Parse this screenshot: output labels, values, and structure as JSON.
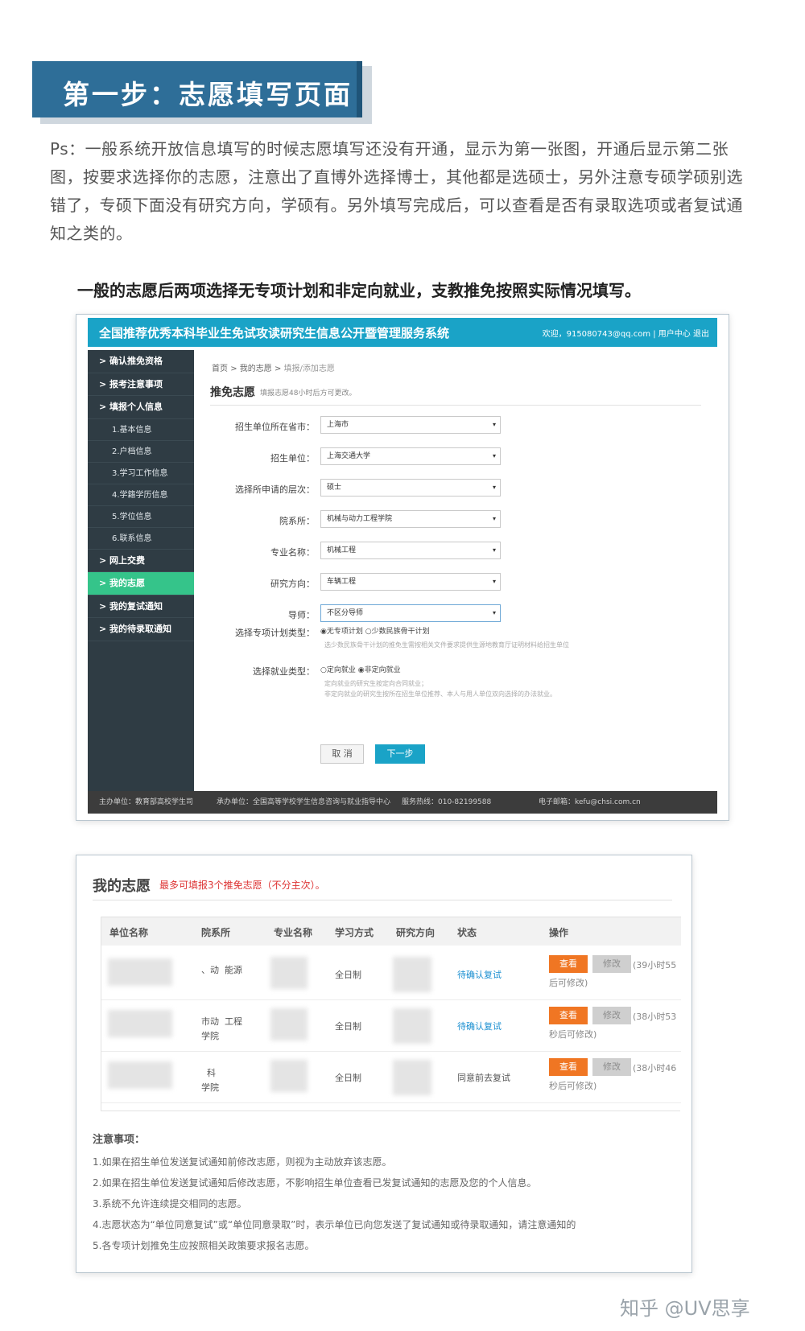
{
  "banner": {
    "title": "第一步：志愿填写页面"
  },
  "intro": "Ps：一般系统开放信息填写的时候志愿填写还没有开通，显示为第一张图，开通后显示第二张图，按要求选择你的志愿，注意出了直博外选择博士，其他都是选硕士，另外注意专硕学硕别选错了，专硕下面没有研究方向，学硕有。另外填写完成后，可以查看是否有录取选项或者复试通知之类的。",
  "subhead": "一般的志愿后两项选择无专项计划和非定向就业，支教推免按照实际情况填写。",
  "screen1": {
    "system_title": "全国推荐优秀本科毕业生免试攻读研究生信息公开暨管理服务系统",
    "user_bar": "欢迎，915080743@qq.com | 用户中心  退出",
    "sidebar": [
      {
        "label": "> 确认推免资格",
        "type": "item"
      },
      {
        "label": "> 报考注意事项",
        "type": "item"
      },
      {
        "label": "> 填报个人信息",
        "type": "item"
      },
      {
        "label": "1.基本信息",
        "type": "sub"
      },
      {
        "label": "2.户档信息",
        "type": "sub"
      },
      {
        "label": "3.学习工作信息",
        "type": "sub"
      },
      {
        "label": "4.学籍学历信息",
        "type": "sub"
      },
      {
        "label": "5.学位信息",
        "type": "sub"
      },
      {
        "label": "6.联系信息",
        "type": "sub"
      },
      {
        "label": "> 网上交费",
        "type": "item"
      },
      {
        "label": "> 我的志愿",
        "type": "active"
      },
      {
        "label": "> 我的复试通知",
        "type": "item"
      },
      {
        "label": "> 我的待录取通知",
        "type": "item"
      }
    ],
    "breadcrumb": {
      "home": "首页",
      "mine": "我的志愿",
      "current": "填报/添加志愿"
    },
    "form_title": "推免志愿",
    "form_note": "填报志愿48小时后方可更改。",
    "fields": [
      {
        "label": "招生单位所在省市：",
        "value": "上海市"
      },
      {
        "label": "招生单位：",
        "value": "上海交通大学"
      },
      {
        "label": "选择所申请的层次：",
        "value": "硕士"
      },
      {
        "label": "院系所：",
        "value": "机械与动力工程学院"
      },
      {
        "label": "专业名称：",
        "value": "机械工程"
      },
      {
        "label": "研究方向：",
        "value": "车辆工程"
      },
      {
        "label": "导师：",
        "value": "不区分导师"
      }
    ],
    "plan": {
      "label": "选择专项计划类型：",
      "options": "◉无专项计划 ○少数民族骨干计划",
      "hint": "选少数民族骨干计划的推免生需按相关文件要求提供生源地教育厅证明材料给招生单位"
    },
    "employ": {
      "label": "选择就业类型：",
      "options": "○定向就业 ◉非定向就业",
      "hint1": "定向就业的研究生按定向合同就业；",
      "hint2": "非定向就业的研究生按所在招生单位推荐、本人与用人单位双向选择的办法就业。"
    },
    "buttons": {
      "cancel": "取 消",
      "next": "下一步"
    },
    "footer": {
      "sponsor": "主办单位：教育部高校学生司",
      "organizer": "承办单位：全国高等学校学生信息咨询与就业指导中心",
      "hotline": "服务热线：010-82199588",
      "email": "电子邮箱：kefu@chsi.com.cn"
    }
  },
  "screen2": {
    "title": "我的志愿",
    "note": "最多可填报3个推免志愿（不分主次）。",
    "headers": [
      "单位名称",
      "院系所",
      "专业名称",
      "学习方式",
      "研究方向",
      "状态",
      "操作"
    ],
    "rows": [
      {
        "dept": "、动  能源",
        "study": "全日制",
        "status": "待确认复试",
        "status_link": true,
        "timer": "(39小时55",
        "timer2": "后可修改)"
      },
      {
        "dept": "市动  工程\n学院",
        "study": "全日制",
        "status": "待确认复试",
        "status_link": true,
        "timer": "(38小时53",
        "timer2": "秒后可修改)"
      },
      {
        "dept": "  科\n学院",
        "study": "全日制",
        "status": "同意前去复试",
        "status_link": false,
        "timer": "(38小时46",
        "timer2": "秒后可修改)"
      }
    ],
    "view_label": "查看",
    "edit_label": "修改",
    "notes_title": "注意事项：",
    "notes": [
      "1.如果在招生单位发送复试通知前修改志愿，则视为主动放弃该志愿。",
      "2.如果在招生单位发送复试通知后修改志愿，不影响招生单位查看已发复试通知的志愿及您的个人信息。",
      "3.系统不允许连续提交相同的志愿。",
      "4.志愿状态为“单位同意复试”或“单位同意录取”时，表示单位已向您发送了复试通知或待录取通知，请注意通知的",
      "5.各专项计划推免生应按照相关政策要求报名志愿。"
    ]
  },
  "watermark": "知乎 @UV思享"
}
